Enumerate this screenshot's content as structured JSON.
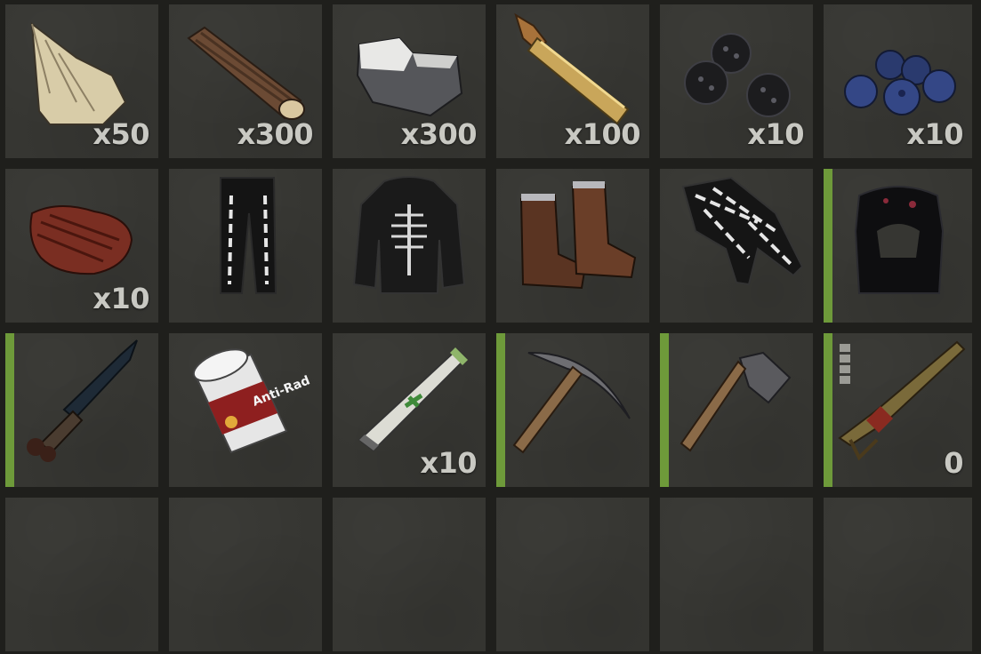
{
  "inventory": {
    "slots": [
      {
        "item": "bone-fragments-icon",
        "quantity": "x50",
        "equipped": false
      },
      {
        "item": "wood-icon",
        "quantity": "x300",
        "equipped": false
      },
      {
        "item": "stones-icon",
        "quantity": "x300",
        "equipped": false
      },
      {
        "item": "rifle-ammo-icon",
        "quantity": "x100",
        "equipped": false
      },
      {
        "item": "blackberries-icon",
        "quantity": "x10",
        "equipped": false
      },
      {
        "item": "blueberries-icon",
        "quantity": "x10",
        "equipped": false
      },
      {
        "item": "cooked-meat-icon",
        "quantity": "x10",
        "equipped": false
      },
      {
        "item": "skeleton-pants-icon",
        "quantity": "",
        "equipped": false
      },
      {
        "item": "skeleton-hoodie-icon",
        "quantity": "",
        "equipped": false
      },
      {
        "item": "boots-icon",
        "quantity": "",
        "equipped": false
      },
      {
        "item": "skeleton-gloves-icon",
        "quantity": "",
        "equipped": false
      },
      {
        "item": "helmet-icon",
        "quantity": "",
        "equipped": true
      },
      {
        "item": "bone-knife-icon",
        "quantity": "",
        "equipped": true
      },
      {
        "item": "anti-rad-pills-icon",
        "quantity": "",
        "equipped": false,
        "label": "Anti-Rad"
      },
      {
        "item": "medical-syringe-icon",
        "quantity": "x10",
        "equipped": false
      },
      {
        "item": "pickaxe-icon",
        "quantity": "",
        "equipped": true
      },
      {
        "item": "hatchet-icon",
        "quantity": "",
        "equipped": true
      },
      {
        "item": "rifle-icon",
        "quantity": "0",
        "equipped": true,
        "ammo_pips": 4
      },
      {
        "item": "empty-slot",
        "quantity": "",
        "equipped": false
      },
      {
        "item": "empty-slot",
        "quantity": "",
        "equipped": false
      },
      {
        "item": "empty-slot",
        "quantity": "",
        "equipped": false
      },
      {
        "item": "empty-slot",
        "quantity": "",
        "equipped": false
      },
      {
        "item": "empty-slot",
        "quantity": "",
        "equipped": false
      },
      {
        "item": "empty-slot",
        "quantity": "",
        "equipped": false
      }
    ]
  },
  "colors": {
    "background": "#1f1f1c",
    "slot": "#363632",
    "equipped_bar": "#6e9a3a",
    "quantity_text": "#c9c9c3"
  }
}
